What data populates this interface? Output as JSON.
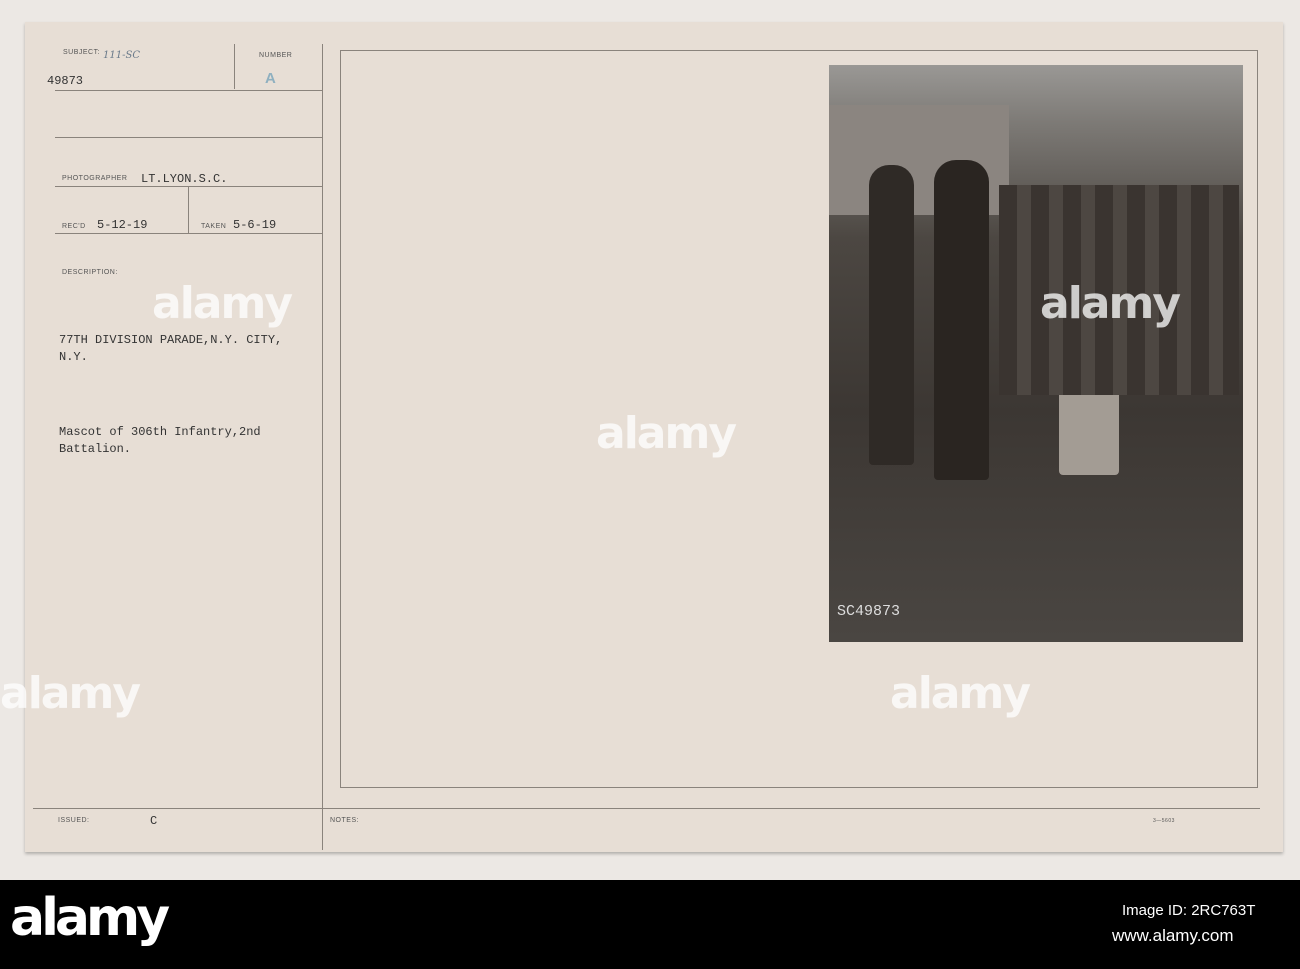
{
  "card": {
    "subject_label": "SUBJECT:",
    "subject_code": "111-SC",
    "subject_number": "49873",
    "number_label": "NUMBER",
    "number_value": "A",
    "photographer_label": "PHOTOGRAPHER",
    "photographer": "LT.LYON.S.C.",
    "recd_label": "REC'D",
    "recd_date": "5-12-19",
    "taken_label": "TAKEN",
    "taken_date": "5-6-19",
    "description_label": "DESCRIPTION:",
    "description_line1": "77TH DIVISION PARADE,N.Y. CITY,",
    "description_line2": "N.Y.",
    "caption_line1": "Mascot of 306th Infantry,2nd",
    "caption_line2": "Battalion.",
    "issued_label": "ISSUED:",
    "issued_value": "C",
    "notes_label": "NOTES:",
    "form_number": "3—5603",
    "photo_number": "SC49873"
  },
  "watermark": {
    "text": "alamy",
    "letter": "a"
  },
  "footer": {
    "logo": "alamy",
    "image_id": "Image ID: 2RC763T",
    "url": "www.alamy.com"
  }
}
